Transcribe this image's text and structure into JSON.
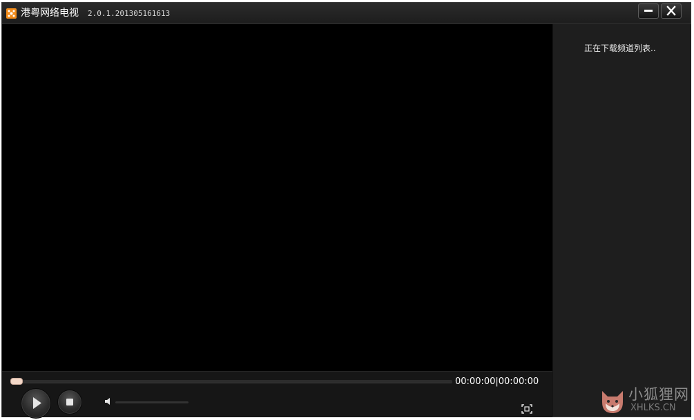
{
  "window": {
    "title": "港粤网络电视",
    "version": "2.0.1.201305161613"
  },
  "side_panel": {
    "status_text": "正在下载频道列表.."
  },
  "player": {
    "time_display": "00:00:00|00:00:00",
    "progress_fraction": 0.0,
    "volume_fraction": 0.0
  },
  "watermark": {
    "line1": "小狐狸网",
    "line2": "XHLKS.CN"
  },
  "icons": {
    "app": "app-logo-icon",
    "minimize": "minimize-icon",
    "close": "close-icon",
    "play": "play-icon",
    "stop": "stop-icon",
    "volume": "speaker-icon",
    "fullscreen": "fullscreen-icon"
  },
  "colors": {
    "app_icon": "#f28c1a",
    "seek_thumb": "#f4d8c8",
    "side_panel_bg": "#1e1e1e",
    "video_bg": "#000000"
  }
}
